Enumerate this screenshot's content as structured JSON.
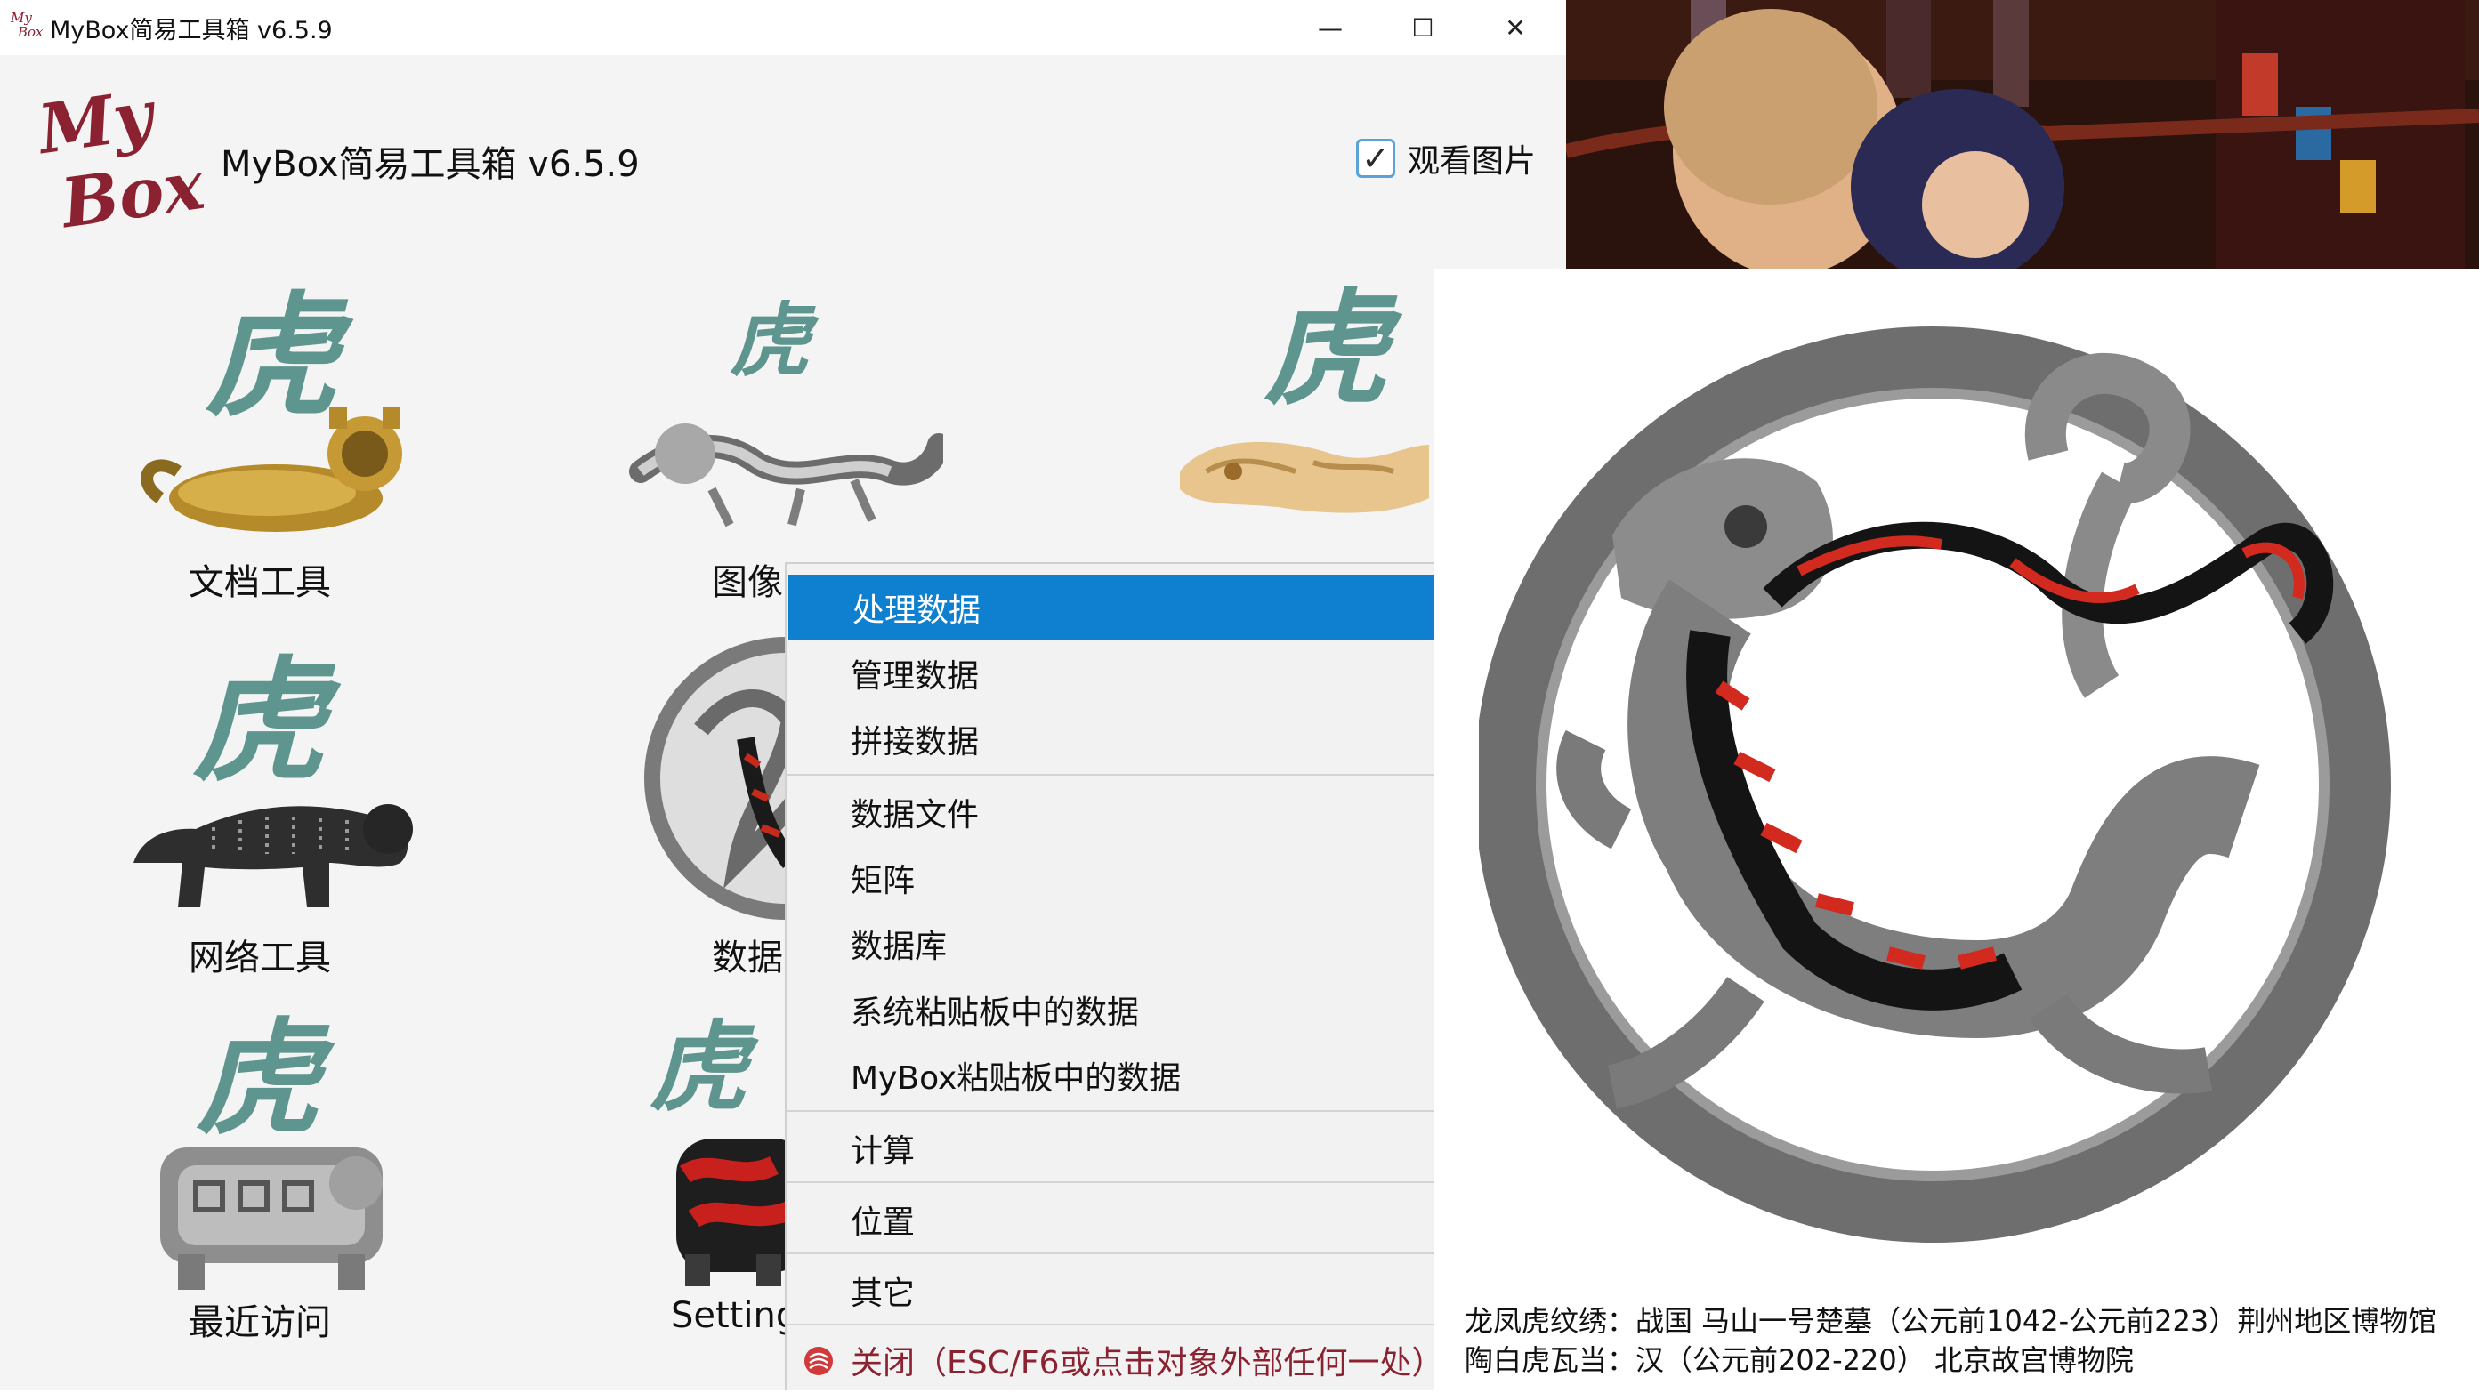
{
  "window": {
    "title": "MyBox简易工具箱 v6.5.9",
    "app_icon_text_line1": "My",
    "app_icon_text_line2": "Box",
    "minimize_glyph": "—",
    "maximize_glyph": "☐",
    "close_glyph": "✕"
  },
  "header": {
    "logo_line1": "My",
    "logo_line2": "Box",
    "app_name": "MyBox简易工具箱 v6.5.9",
    "view_images": {
      "label": "观看图片",
      "checked": true,
      "check_glyph": "✓"
    }
  },
  "tools": [
    {
      "label": "文档工具",
      "calligraphy": "虎",
      "icon": "gold-tiger-icon"
    },
    {
      "label": "图像",
      "calligraphy": "虎",
      "icon": "silver-dragon-tiger-icon"
    },
    {
      "label": "",
      "calligraphy": "虎",
      "icon": "jade-tiger-icon"
    },
    {
      "label": "网络工具",
      "calligraphy": "虎",
      "icon": "black-bronze-tiger-icon"
    },
    {
      "label": "数据",
      "calligraphy": "",
      "icon": "tile-tiger-icon"
    },
    {
      "label": "最近访问",
      "calligraphy": "虎",
      "icon": "stone-tiger-icon"
    },
    {
      "label": "Setting",
      "calligraphy": "虎",
      "icon": "red-lacquer-tiger-icon"
    }
  ],
  "context_menu": {
    "items": [
      {
        "label": "处理数据",
        "selected": true
      },
      {
        "label": "管理数据"
      },
      {
        "label": "拼接数据"
      },
      {
        "label": "数据文件"
      },
      {
        "label": "矩阵"
      },
      {
        "label": "数据库"
      },
      {
        "label": "系统粘贴板中的数据"
      },
      {
        "label": "MyBox粘贴板中的数据"
      },
      {
        "label": "计算"
      },
      {
        "label": "位置"
      },
      {
        "label": "其它"
      },
      {
        "label": "关闭（ESC/F6或点击对象外部任何一处）",
        "icon": "close-circle-icon"
      }
    ],
    "colors": {
      "selected_bg": "#0f7fcf",
      "selected_fg": "#ffffff",
      "close_icon": "#d03a3a"
    }
  },
  "image_panel": {
    "caption_line1": "龙凤虎纹绣：战国 马山一号楚墓（公元前1042-公元前223）荆州地区博物馆",
    "caption_line2": "陶白虎瓦当：汉（公元前202-220） 北京故宫博物院",
    "image": "tiger-tile-rubbing-image"
  },
  "banner": {
    "image": "anime-bar-scene-image"
  }
}
